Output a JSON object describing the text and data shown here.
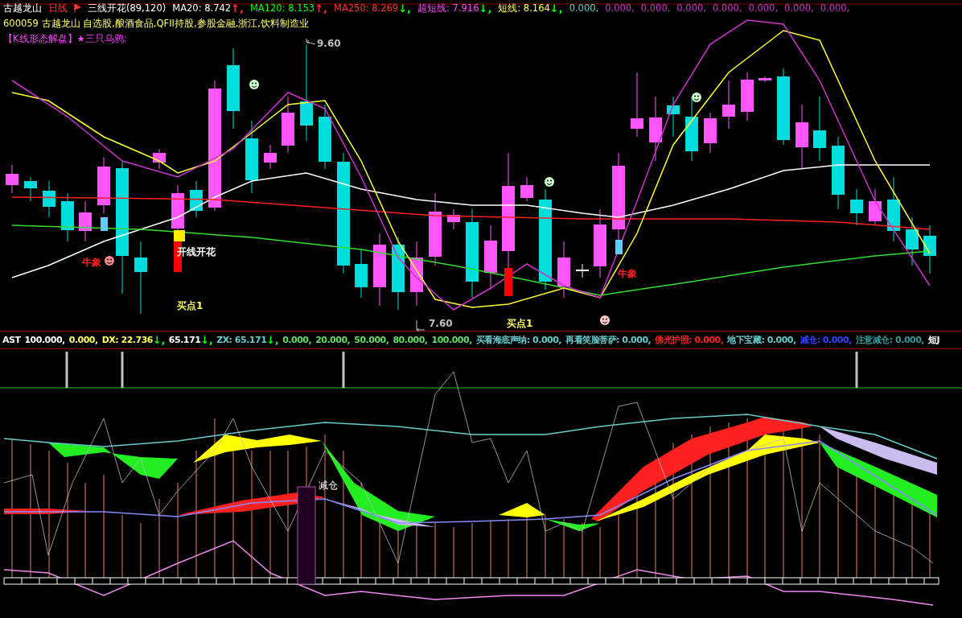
{
  "header": {
    "stock_name": "古越龙山",
    "period": "日线",
    "formula": "三线开花(89,120)",
    "readings": [
      {
        "text": "MA20: 8.742",
        "arrow": {
          "text": "↑,",
          "color": "#ff3030"
        },
        "color": "#ffffff"
      },
      {
        "text": "MA120: 8.153",
        "arrow": {
          "text": "↑,",
          "color": "#ff3030"
        },
        "color": "#00ff00"
      },
      {
        "text": "MA250: 8.269",
        "arrow": {
          "text": "↓,",
          "color": "#00ff00"
        },
        "color": "#ff3030"
      },
      {
        "text": "超短线: 7.916",
        "arrow": {
          "text": "↓,",
          "color": "#00ff00"
        },
        "color": "#ff44ff"
      },
      {
        "text": "短线: 8.164",
        "arrow": {
          "text": "↓,",
          "color": "#00ff00"
        },
        "color": "#ffff66"
      },
      {
        "text": "0.000,",
        "color": "#66cccc"
      },
      {
        "text": "0.000,",
        "color": "#cc33cc"
      },
      {
        "text": "0.000,",
        "color": "#cc33cc"
      },
      {
        "text": "0.000,",
        "color": "#cc33cc"
      },
      {
        "text": "0.000,",
        "color": "#cc33cc"
      },
      {
        "text": "0.000,",
        "color": "#cc33cc"
      },
      {
        "text": "0.000,",
        "color": "#cc33cc"
      },
      {
        "text": "0.000,",
        "color": "#cc33cc"
      }
    ]
  },
  "info_line": "600059 古越龙山 自选股,酿酒食品,QFII持股,参股金融,浙江,饮料制造业",
  "pattern_line": "【K线形态解盘】★三只乌鸦:",
  "annotations": [
    {
      "text": "9.60",
      "color": "#c0c0c0"
    },
    {
      "text": "牛象",
      "color": "#ff2020"
    },
    {
      "text": "开线开花",
      "color": "#ffffff"
    },
    {
      "text": "买点1",
      "color": "#ffff66"
    },
    {
      "text": "7.60",
      "color": "#c0c0c0"
    },
    {
      "text": "买点1",
      "color": "#ffff66"
    },
    {
      "text": "牛象",
      "color": "#ff2020"
    }
  ],
  "indicator": {
    "readings": [
      {
        "text": "AST",
        "color": "#ffffff"
      },
      {
        "text": "100.000,",
        "color": "#ffffff"
      },
      {
        "text": "0.000,",
        "color": "#ffff66"
      },
      {
        "text": "DX: 22.736",
        "arrow": {
          "text": "↓,",
          "color": "#00ff00"
        },
        "color": "#ffff66"
      },
      {
        "text": "65.171",
        "arrow": {
          "text": "↓,",
          "color": "#00ff00"
        },
        "color": "#ffffff"
      },
      {
        "text": "ZX: 65.171",
        "arrow": {
          "text": "↓,",
          "color": "#00ff00"
        },
        "color": "#66cccc"
      },
      {
        "text": "0.000,",
        "color": "#66dd66"
      },
      {
        "text": "20.000,",
        "color": "#66dd66"
      },
      {
        "text": "50.000,",
        "color": "#66dd66"
      },
      {
        "text": "80.000,",
        "color": "#66dd66"
      },
      {
        "text": "100.000,",
        "color": "#66dd66"
      },
      {
        "text": "买看海底声纳: 0.000,",
        "color": "#66cccc"
      },
      {
        "text": "再看笑脸菩萨: 0.000,",
        "color": "#66cccc"
      },
      {
        "text": "佛光护照: 0.000,",
        "color": "#ff2020"
      },
      {
        "text": "地下宝藏: 0.000,",
        "color": "#66cccc"
      },
      {
        "text": "减仓: 0.000,",
        "color": "#3344ff"
      },
      {
        "text": "注意减仓: 0.000,",
        "color": "#339999"
      },
      {
        "text": "短J",
        "color": "#ffffff"
      }
    ],
    "marker_label": "减仓"
  }
}
